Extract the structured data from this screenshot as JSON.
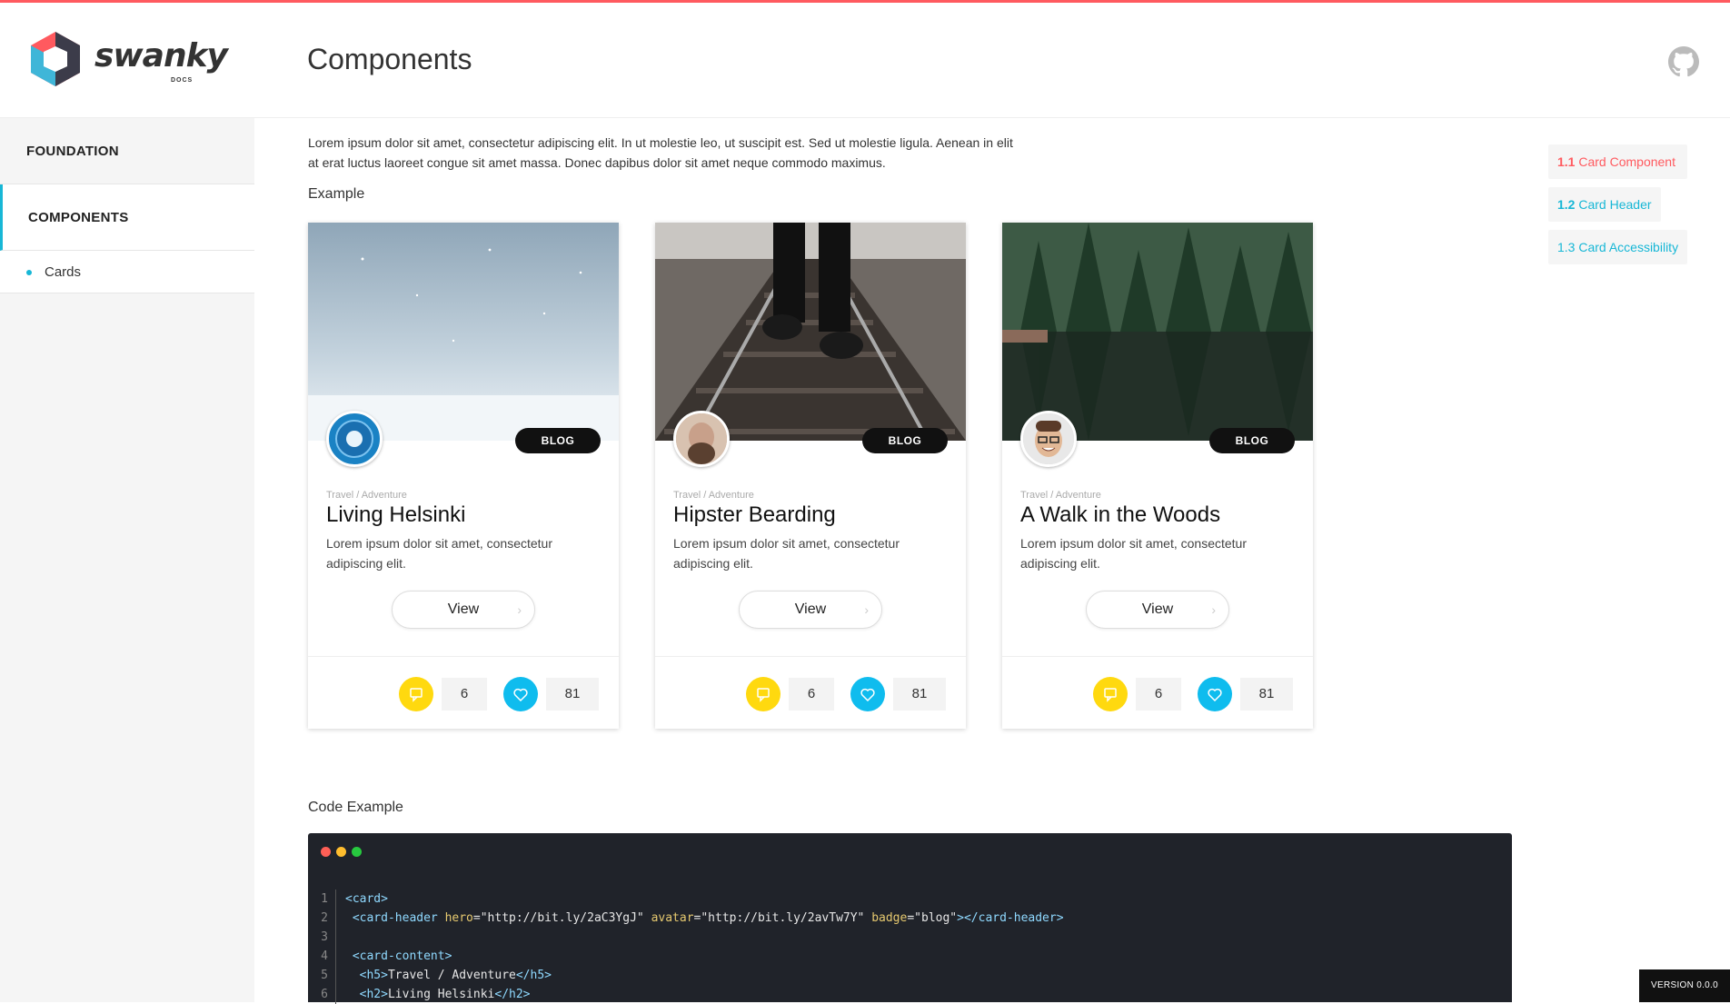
{
  "header": {
    "logo_text": "swanky",
    "logo_sub": "DOCS",
    "title": "Components"
  },
  "sidebar": {
    "items": [
      {
        "label": "FOUNDATION"
      },
      {
        "label": "COMPONENTS"
      }
    ],
    "sub_items": [
      {
        "label": "Cards"
      }
    ]
  },
  "main": {
    "intro": "Lorem ipsum dolor sit amet, consectetur adipiscing elit. In ut molestie leo, ut suscipit est. Sed ut molestie ligula. Aenean in elit at erat luctus laoreet congue sit amet massa. Donec dapibus dolor sit amet neque commodo maximus.",
    "example_label": "Example",
    "code_label": "Code Example"
  },
  "cards": [
    {
      "badge": "BLOG",
      "kicker": "Travel / Adventure",
      "title": "Living Helsinki",
      "desc": "Lorem ipsum dolor sit amet, consectetur adipiscing elit.",
      "button": "View",
      "comments": "6",
      "likes": "81"
    },
    {
      "badge": "BLOG",
      "kicker": "Travel / Adventure",
      "title": "Hipster Bearding",
      "desc": "Lorem ipsum dolor sit amet, consectetur adipiscing elit.",
      "button": "View",
      "comments": "6",
      "likes": "81"
    },
    {
      "badge": "BLOG",
      "kicker": "Travel / Adventure",
      "title": "A Walk in the Woods",
      "desc": "Lorem ipsum dolor sit amet, consectetur adipiscing elit.",
      "button": "View",
      "comments": "6",
      "likes": "81"
    }
  ],
  "toc": [
    {
      "num": "1.1",
      "label": "Card Component",
      "color": "#ff5a5f"
    },
    {
      "num": "1.2",
      "label": "Card Header",
      "color": "#17b7d6"
    },
    {
      "num": "1.3",
      "label": "Card Accessibility",
      "color": "#17b7d6"
    }
  ],
  "code": {
    "lines": [
      {
        "n": "1",
        "parts": [
          [
            "tag",
            "<card>"
          ]
        ]
      },
      {
        "n": "2",
        "parts": [
          [
            "tag",
            " <card-header "
          ],
          [
            "attr",
            "hero"
          ],
          [
            "str",
            "=\"http://bit.ly/2aC3YgJ\" "
          ],
          [
            "attr",
            "avatar"
          ],
          [
            "str",
            "=\"http://bit.ly/2avTw7Y\" "
          ],
          [
            "attr",
            "badge"
          ],
          [
            "str",
            "=\"blog\""
          ],
          [
            "tag",
            "></card-header>"
          ]
        ]
      },
      {
        "n": "3",
        "parts": []
      },
      {
        "n": "4",
        "parts": [
          [
            "tag",
            " <card-content>"
          ]
        ]
      },
      {
        "n": "5",
        "parts": [
          [
            "tag",
            "  <h5>"
          ],
          [
            "txt",
            "Travel / Adventure"
          ],
          [
            "tag",
            "</h5>"
          ]
        ]
      },
      {
        "n": "6",
        "parts": [
          [
            "tag",
            "  <h2>"
          ],
          [
            "txt",
            "Living Helsinki"
          ],
          [
            "tag",
            "</h2>"
          ]
        ]
      }
    ]
  },
  "colors": {
    "accent_red": "#ff5a5f",
    "accent_cyan": "#17b7d6",
    "comment_yellow": "#ffd90f",
    "like_blue": "#0fbcee"
  },
  "footer": {
    "version": "VERSION 0.0.0"
  }
}
